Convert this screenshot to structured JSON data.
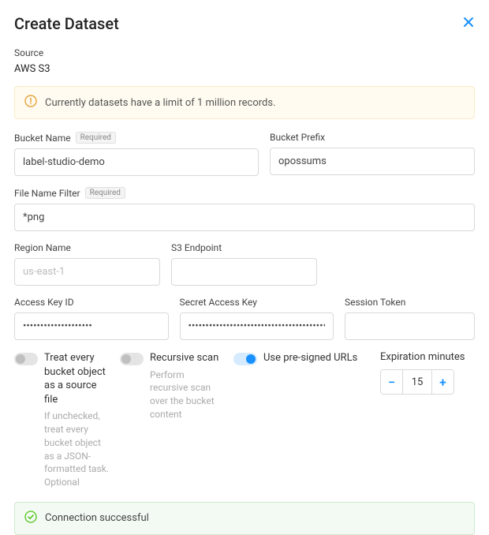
{
  "header": {
    "title": "Create Dataset",
    "close_name": "close-icon"
  },
  "source": {
    "label": "Source",
    "value": "AWS S3"
  },
  "warning": {
    "text": "Currently datasets have a limit of 1 million records."
  },
  "fields": {
    "bucket_name": {
      "label": "Bucket Name",
      "required": "Required",
      "value": "label-studio-demo"
    },
    "bucket_prefix": {
      "label": "Bucket Prefix",
      "value": "opossums"
    },
    "file_filter": {
      "label": "File Name Filter",
      "required": "Required",
      "value": "*png"
    },
    "region": {
      "label": "Region Name",
      "placeholder": "us-east-1",
      "value": ""
    },
    "endpoint": {
      "label": "S3 Endpoint",
      "value": ""
    },
    "access_key": {
      "label": "Access Key ID",
      "value": "••••••••••••••••••••"
    },
    "secret_key": {
      "label": "Secret Access Key",
      "value": "••••••••••••••••••••••••••••••••••••••••"
    },
    "session_token": {
      "label": "Session Token",
      "value": ""
    }
  },
  "toggles": {
    "treat_source": {
      "label": "Treat every bucket object as a source file",
      "desc": "If unchecked, treat every bucket object as a JSON-formatted task. Optional",
      "on": false
    },
    "recursive": {
      "label": "Recursive scan",
      "desc": "Perform recursive scan over the bucket content",
      "on": false
    },
    "presigned": {
      "label": "Use pre-signed URLs",
      "on": true
    }
  },
  "expiration": {
    "label": "Expiration minutes",
    "value": "15"
  },
  "status": {
    "text": "Connection successful"
  }
}
